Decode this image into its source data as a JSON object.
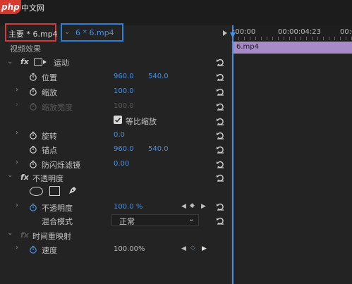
{
  "logo": "php",
  "logo_suffix": "中文网",
  "tabs": {
    "master": "主要 * 6.mp4",
    "clip": "6 * 6.mp4"
  },
  "timeline": {
    "start_time": ":00:00",
    "mid_time": "00:00:04:23",
    "end_time": "00:0",
    "clip_label": "6.mp4"
  },
  "section_video": "视频效果",
  "motion": {
    "title": "运动",
    "position": {
      "label": "位置",
      "x": "960.0",
      "y": "540.0"
    },
    "scale": {
      "label": "缩放",
      "value": "100.0"
    },
    "scale_width": {
      "label": "缩放宽度",
      "value": "100.0"
    },
    "uniform_scale": {
      "label": "等比缩放",
      "checked": true
    },
    "rotation": {
      "label": "旋转",
      "value": "0.0"
    },
    "anchor": {
      "label": "锚点",
      "x": "960.0",
      "y": "540.0"
    },
    "antiflicker": {
      "label": "防闪烁滤镜",
      "value": "0.00"
    }
  },
  "opacity_fx": {
    "title": "不透明度",
    "opacity": {
      "label": "不透明度",
      "value": "100.0 %"
    },
    "blend": {
      "label": "混合模式",
      "value": "正常"
    }
  },
  "time_remap": {
    "title": "时间重映射",
    "speed": {
      "label": "速度",
      "value": "100.00%"
    }
  },
  "colors": {
    "accent": "#4a8fe0",
    "highlight_red": "#d23c3c",
    "highlight_blue": "#2f7fd6",
    "clip_purple": "#a78ac8"
  }
}
